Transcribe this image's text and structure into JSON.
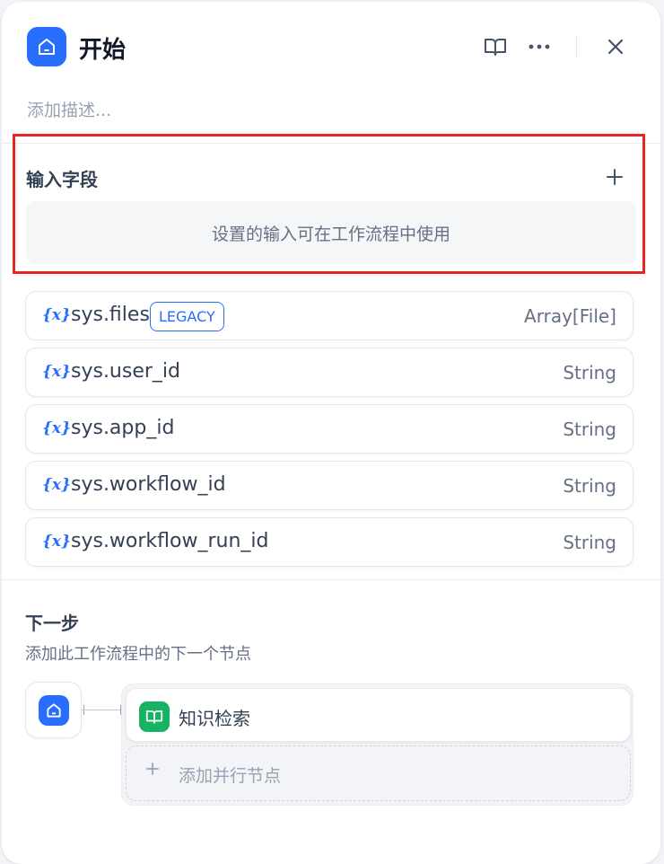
{
  "header": {
    "title": "开始",
    "icons": {
      "node": "home-icon",
      "docs": "book-open-icon",
      "more": "more-horizontal-icon",
      "close": "close-icon"
    }
  },
  "description": {
    "placeholder": "添加描述..."
  },
  "input_fields": {
    "title": "输入字段",
    "add_icon": "plus-icon",
    "empty_text": "设置的输入可在工作流程中使用",
    "highlight_color": "#e5261f"
  },
  "variables": [
    {
      "icon": "{x}",
      "name": "sys.files",
      "badge": "LEGACY",
      "type": "Array[File]"
    },
    {
      "icon": "{x}",
      "name": "sys.user_id",
      "type": "String"
    },
    {
      "icon": "{x}",
      "name": "sys.app_id",
      "type": "String"
    },
    {
      "icon": "{x}",
      "name": "sys.workflow_id",
      "type": "String"
    },
    {
      "icon": "{x}",
      "name": "sys.workflow_run_id",
      "type": "String"
    }
  ],
  "next_step": {
    "title": "下一步",
    "description": "添加此工作流程中的下一个节点",
    "source_icon": "home-icon",
    "nodes": [
      {
        "label": "知识检索",
        "icon": "book-icon",
        "color": "#16b364"
      }
    ],
    "add_parallel_label": "添加并行节点"
  },
  "colors": {
    "accent": "#296dff",
    "knowledge": "#16b364"
  }
}
